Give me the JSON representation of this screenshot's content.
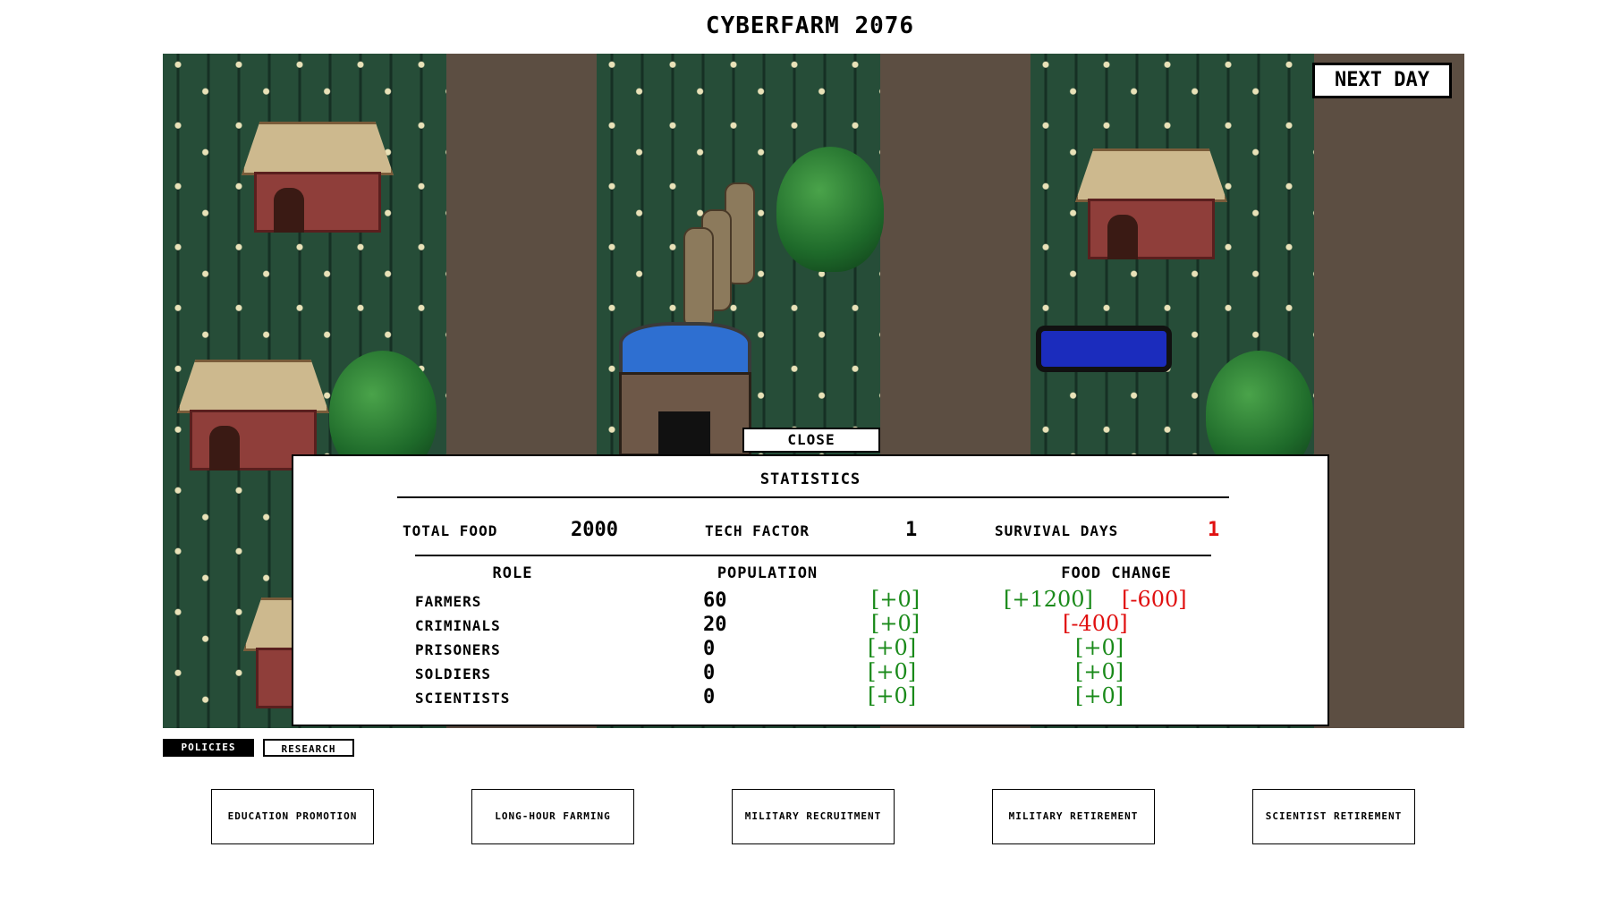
{
  "title": "CYBERFARM 2076",
  "controls": {
    "next_day": "NEXT DAY",
    "close": "CLOSE"
  },
  "statistics": {
    "title": "STATISTICS",
    "total_food_label": "TOTAL FOOD",
    "total_food_value": "2000",
    "tech_factor_label": "TECH FACTOR",
    "tech_factor_value": "1",
    "survival_days_label": "SURVIVAL DAYS",
    "survival_days_value": "1",
    "headers": {
      "role": "ROLE",
      "population": "POPULATION",
      "food_change": "FOOD CHANGE"
    },
    "rows": [
      {
        "role": "FARMERS",
        "population": "60",
        "pop_change": "[+0]",
        "food_gain": "[+1200]",
        "food_loss": "[-600]"
      },
      {
        "role": "CRIMINALS",
        "population": "20",
        "pop_change": "[+0]",
        "food_gain": "",
        "food_loss": "[-400]"
      },
      {
        "role": "PRISONERS",
        "population": "0",
        "pop_change": "[+0]",
        "food_gain": "[+0]",
        "food_loss": ""
      },
      {
        "role": "SOLDIERS",
        "population": "0",
        "pop_change": "[+0]",
        "food_gain": "[+0]",
        "food_loss": ""
      },
      {
        "role": "SCIENTISTS",
        "population": "0",
        "pop_change": "[+0]",
        "food_gain": "[+0]",
        "food_loss": ""
      }
    ],
    "colors": {
      "positive": "#1a8a1a",
      "negative": "#e01010"
    }
  },
  "tabs": {
    "policies": "POLICIES",
    "research": "RESEARCH",
    "active": "policies"
  },
  "policies": [
    {
      "label": "EDUCATION PROMOTION"
    },
    {
      "label": "LONG-HOUR FARMING"
    },
    {
      "label": "MILITARY RECRUITMENT"
    },
    {
      "label": "MILITARY RETIREMENT"
    },
    {
      "label": "SCIENTIST RETIREMENT"
    }
  ]
}
